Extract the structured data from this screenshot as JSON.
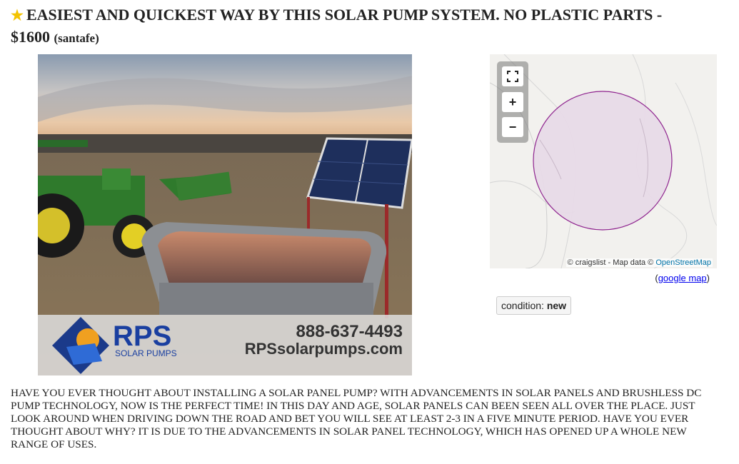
{
  "posting": {
    "star": "★",
    "title": "EASIEST AND QUICKEST WAY BY THIS SOLAR PUMP SYSTEM. NO PLASTIC PARTS -",
    "price": "$1600",
    "location": "(santafe)"
  },
  "photo": {
    "brand": "RPS",
    "brand_sub": "SOLAR PUMPS",
    "phone": "888-637-4493",
    "website": "RPSsolarpumps.com"
  },
  "map": {
    "fullscreen_icon": "fullscreen-icon",
    "zoom_in": "+",
    "zoom_out": "−",
    "attribution_prefix": "© craigslist - Map data ©",
    "attribution_link": "OpenStreetMap",
    "google_map_open": "(",
    "google_map_link": "google map",
    "google_map_close": ")",
    "circle_fill": "#e8dbe8",
    "circle_stroke": "#8a1a8a"
  },
  "attributes": {
    "condition_label": "condition:",
    "condition_value": "new"
  },
  "body": {
    "text": "HAVE YOU EVER THOUGHT ABOUT INSTALLING A SOLAR PANEL PUMP? WITH ADVANCEMENTS IN SOLAR PANELS AND BRUSHLESS DC PUMP TECHNOLOGY, NOW IS THE PERFECT TIME! IN THIS DAY AND AGE, SOLAR PANELS CAN BEEN SEEN ALL OVER THE PLACE. JUST LOOK AROUND WHEN DRIVING DOWN THE ROAD AND BET YOU WILL SEE AT LEAST 2-3 IN A FIVE MINUTE PERIOD. HAVE YOU EVER THOUGHT ABOUT WHY? IT IS DUE TO THE ADVANCEMENTS IN SOLAR PANEL TECHNOLOGY, WHICH HAS OPENED UP A WHOLE NEW RANGE OF USES."
  }
}
